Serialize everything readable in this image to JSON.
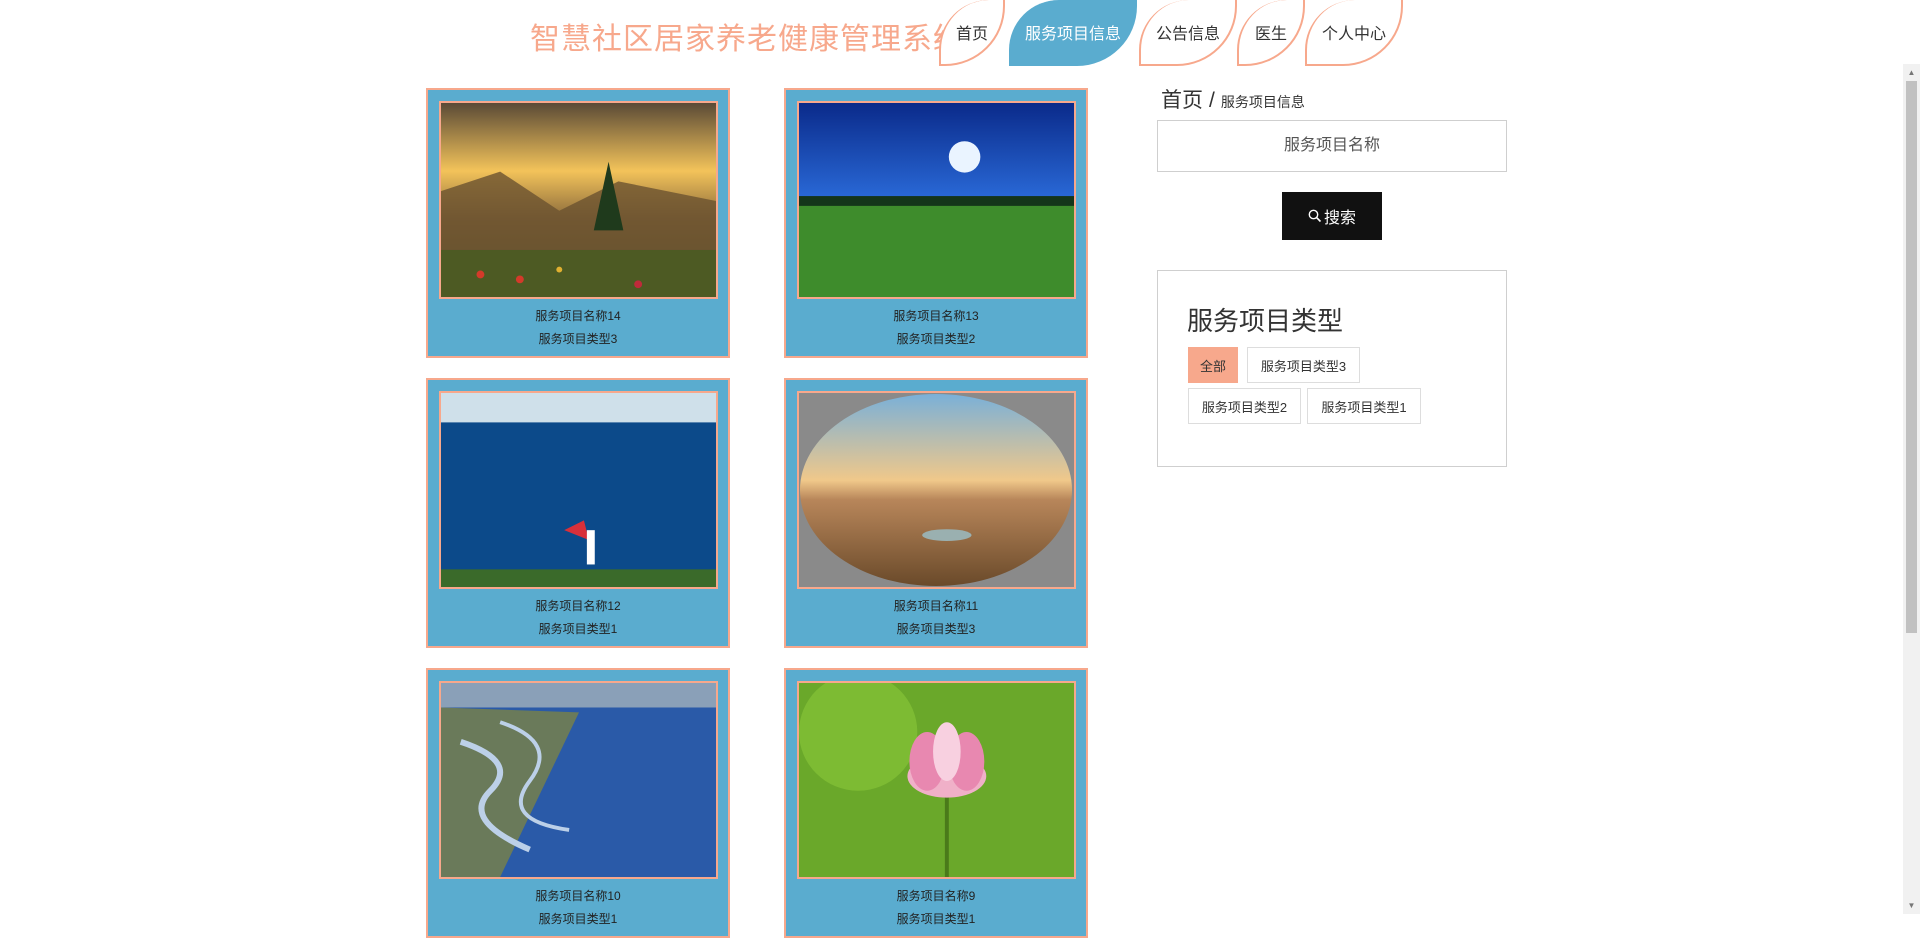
{
  "header": {
    "title": "智慧社区居家养老健康管理系统",
    "nav": [
      {
        "label": "首页"
      },
      {
        "label": "服务项目信息",
        "active": true
      },
      {
        "label": "公告信息"
      },
      {
        "label": "医生"
      },
      {
        "label": "个人中心"
      }
    ]
  },
  "cards": [
    {
      "name": "服务项目名称14",
      "type": "服务项目类型3",
      "image": "mountain-sunset"
    },
    {
      "name": "服务项目名称13",
      "type": "服务项目类型2",
      "image": "moonlit-meadow"
    },
    {
      "name": "服务项目名称12",
      "type": "服务项目类型1",
      "image": "lake-dancer"
    },
    {
      "name": "服务项目名称11",
      "type": "服务项目类型3",
      "image": "desert-oasis"
    },
    {
      "name": "服务项目名称10",
      "type": "服务项目类型1",
      "image": "lake-shore"
    },
    {
      "name": "服务项目名称9",
      "type": "服务项目类型1",
      "image": "lotus-flower"
    }
  ],
  "breadcrumb": {
    "home": "首页",
    "separator": "/",
    "current": "服务项目信息"
  },
  "search": {
    "placeholder": "服务项目名称",
    "button_label": "搜索",
    "icon": "search-icon"
  },
  "categories": {
    "title": "服务项目类型",
    "tags": [
      {
        "label": "全部",
        "active": true
      },
      {
        "label": "服务项目类型3"
      },
      {
        "label": "服务项目类型2"
      },
      {
        "label": "服务项目类型1"
      }
    ]
  },
  "colors": {
    "accent": "#f7a88c",
    "card_bg": "#5aaccf",
    "button": "#111111"
  }
}
